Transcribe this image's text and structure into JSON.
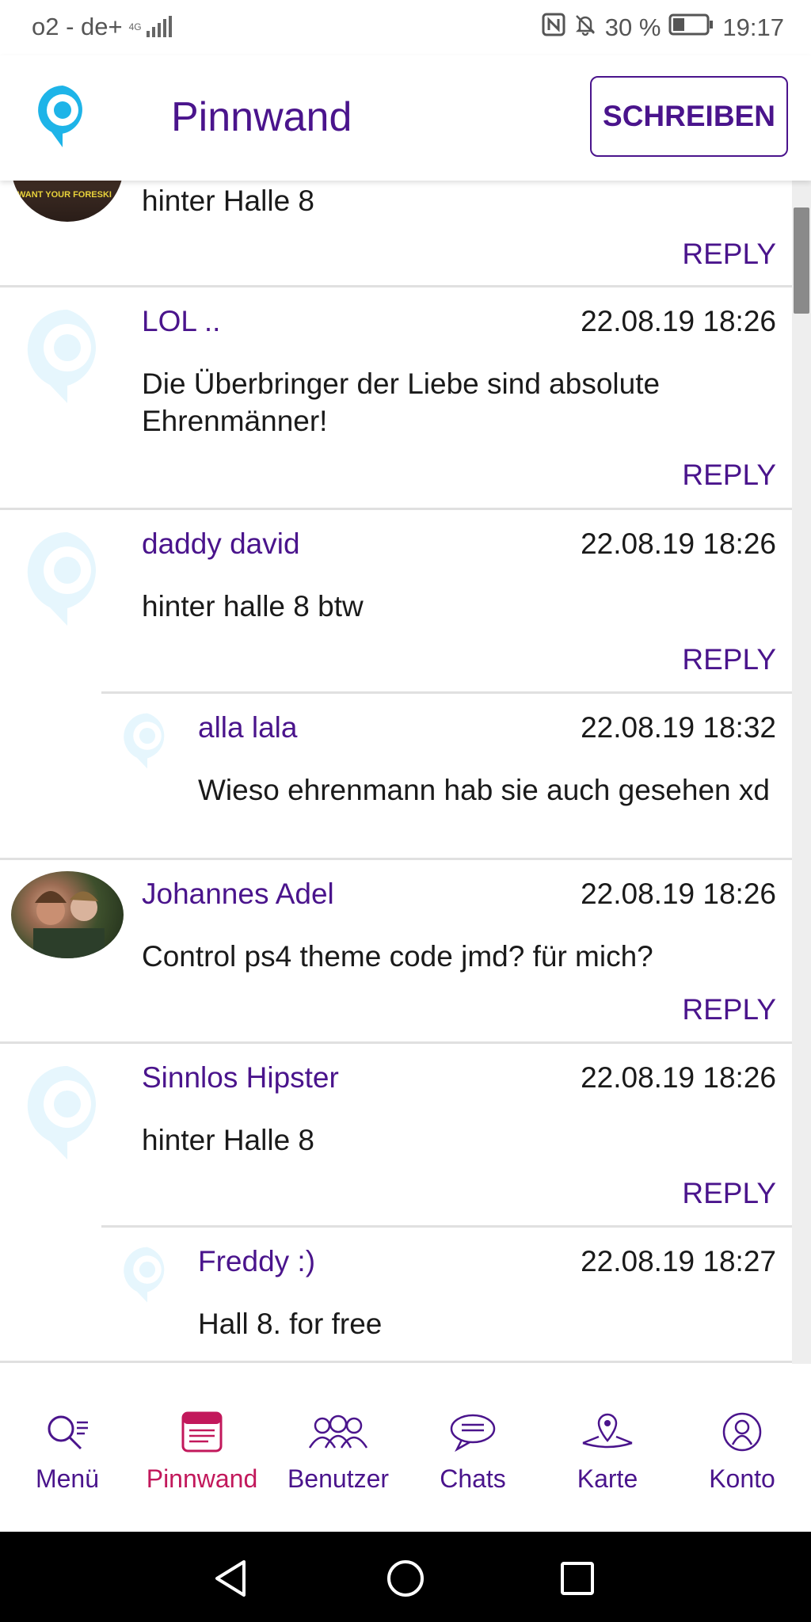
{
  "status_bar": {
    "carrier": "o2 - de+",
    "network": "4G",
    "battery": "30 %",
    "time": "19:17"
  },
  "header": {
    "title": "Pinnwand",
    "write_button": "SCHREIBEN"
  },
  "avatar_image_text": "WANT YOUR FORESKI",
  "posts": [
    {
      "author": "",
      "time": "",
      "body": "hinter Halle 8",
      "reply": "REPLY"
    },
    {
      "author": "LOL ..",
      "time": "22.08.19 18:26",
      "body": "Die Überbringer der Liebe sind absolute Ehrenmänner!",
      "reply": "REPLY"
    },
    {
      "author": "daddy david",
      "time": "22.08.19 18:26",
      "body": "hinter halle 8 btw",
      "reply": "REPLY"
    },
    {
      "author": "alla lala",
      "time": "22.08.19 18:32",
      "body": "Wieso ehrenmann hab sie auch gesehen xd",
      "reply": ""
    },
    {
      "author": "Johannes Adel",
      "time": "22.08.19 18:26",
      "body": "Control ps4 theme code jmd? für mich?",
      "reply": "REPLY"
    },
    {
      "author": "Sinnlos Hipster",
      "time": "22.08.19 18:26",
      "body": "hinter Halle 8",
      "reply": "REPLY"
    },
    {
      "author": "Freddy :)",
      "time": "22.08.19 18:27",
      "body": "Hall 8. for free",
      "reply": ""
    }
  ],
  "bottom_nav": [
    {
      "label": "Menü",
      "icon": "search-menu-icon",
      "active": false
    },
    {
      "label": "Pinnwand",
      "icon": "board-icon",
      "active": true
    },
    {
      "label": "Benutzer",
      "icon": "users-icon",
      "active": false
    },
    {
      "label": "Chats",
      "icon": "chat-bubble-icon",
      "active": false
    },
    {
      "label": "Karte",
      "icon": "map-pin-icon",
      "active": false
    },
    {
      "label": "Konto",
      "icon": "account-icon",
      "active": false
    }
  ],
  "colors": {
    "accent": "#4a148c",
    "active_nav": "#c2185b",
    "logo": "#1eb4e8",
    "placeholder_avatar": "#e6f6fd"
  }
}
